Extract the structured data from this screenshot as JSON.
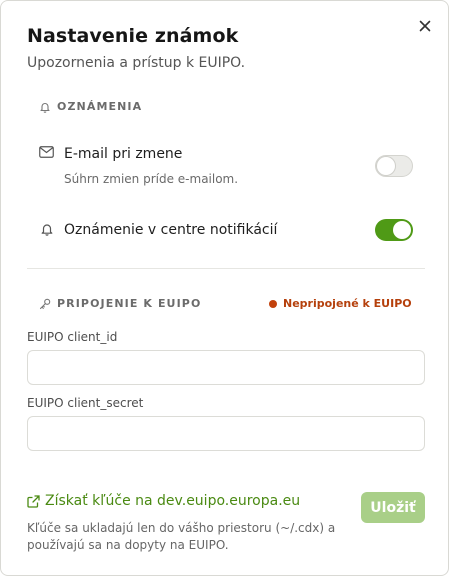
{
  "dialog": {
    "title": "Nastavenie známok",
    "subtitle": "Upozornenia a prístup k EUIPO.",
    "close_icon": "close-icon"
  },
  "notifications": {
    "heading": "OZNÁMENIA",
    "heading_icon": "bell-icon",
    "items": [
      {
        "icon": "mail-icon",
        "label": "E-mail pri zmene",
        "description": "Súhrn zmien príde e-mailom.",
        "enabled": false
      },
      {
        "icon": "bell-icon",
        "label": "Oznámenie v centre notifikácií",
        "enabled": true
      }
    ]
  },
  "connection": {
    "heading": "PRIPOJENIE K EUIPO",
    "heading_icon": "key-icon",
    "status": "Nepripojené k EUIPO",
    "status_color": "#c2410c",
    "fields": [
      {
        "label": "EUIPO client_id",
        "value": "",
        "placeholder": ""
      },
      {
        "label": "EUIPO client_secret",
        "value": "",
        "placeholder": ""
      }
    ]
  },
  "footer": {
    "link_label": "Získať kľúče na dev.euipo.europa.eu",
    "link_icon": "external-link-icon",
    "save_label": "Uložiť",
    "note": "Kľúče sa ukladajú len do vášho priestoru (~/.cdx) a používajú sa na dopyty na EUIPO."
  },
  "colors": {
    "accent": "#4f9a16",
    "link": "#4a8a12",
    "save_disabled": "#a9cf88",
    "status": "#c2410c"
  }
}
